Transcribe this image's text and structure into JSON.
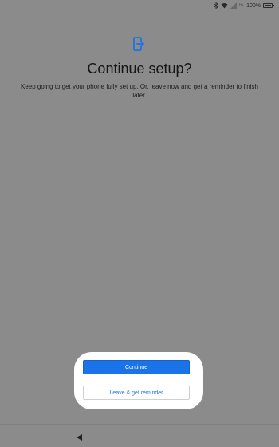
{
  "status_bar": {
    "battery_text": "100%",
    "network_label": "H+"
  },
  "page": {
    "title": "Continue setup?",
    "description": "Keep going to get your phone fully set up. Or, leave now and get a reminder to finish later."
  },
  "actions": {
    "continue_label": "Continue",
    "leave_label": "Leave & get reminder"
  },
  "colors": {
    "accent": "#1a73e8",
    "background": "#8b8b8b"
  },
  "icons": {
    "header": "phone-exit-icon",
    "back": "back-triangle-icon"
  }
}
